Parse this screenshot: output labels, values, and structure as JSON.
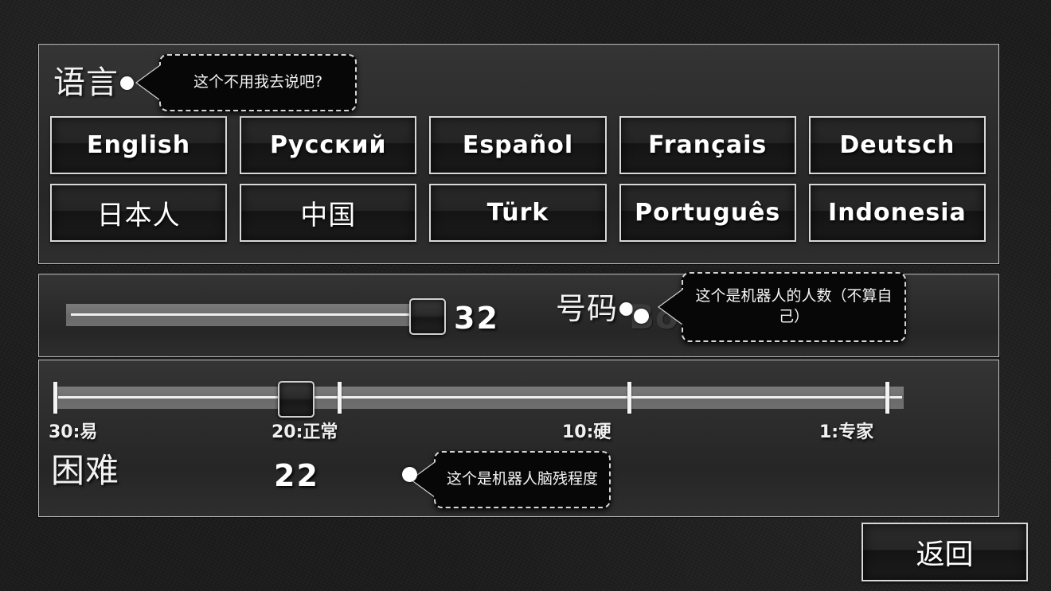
{
  "language_section": {
    "title": "语言",
    "buttons": [
      {
        "label": "English",
        "script": "latin"
      },
      {
        "label": "Русский",
        "script": "latin"
      },
      {
        "label": "Español",
        "script": "latin"
      },
      {
        "label": "Français",
        "script": "latin"
      },
      {
        "label": "Deutsch",
        "script": "latin"
      },
      {
        "label": "日本人",
        "script": "cjk"
      },
      {
        "label": "中国",
        "script": "cjk"
      },
      {
        "label": "Türk",
        "script": "latin"
      },
      {
        "label": "Português",
        "script": "latin"
      },
      {
        "label": "Indonesia",
        "script": "latin"
      }
    ]
  },
  "bots_section": {
    "label": "号码",
    "value": "32",
    "watermark": "Bots",
    "slider": {
      "min": 0,
      "max": 32,
      "value": 32,
      "fill_percent": 100
    }
  },
  "difficulty_section": {
    "label": "困难",
    "value": "22",
    "slider": {
      "min": 1,
      "max": 30,
      "value": 22,
      "handle_percent": 28
    },
    "ticks": [
      {
        "label": "30:易",
        "percent": 0
      },
      {
        "label": "20:正常",
        "percent": 35
      },
      {
        "label": "10:硬",
        "percent": 69
      },
      {
        "label": "1:专家",
        "percent": 100
      }
    ]
  },
  "tooltips": [
    {
      "id": "lang",
      "text": "这个不用我去说吧?"
    },
    {
      "id": "bots",
      "text": "这个是机器人的人数（不算自己）"
    },
    {
      "id": "diff",
      "text": "这个是机器人脑残程度"
    }
  ],
  "back_button": {
    "label": "返回"
  },
  "colors": {
    "background": "#1a1a1a",
    "panel": "#2c2c2c",
    "panel_border": "#b9b9b9",
    "button_border": "#d8d8d8",
    "text": "#ffffff",
    "track": "#6e6e6e",
    "tooltip_bg": "#070707"
  }
}
